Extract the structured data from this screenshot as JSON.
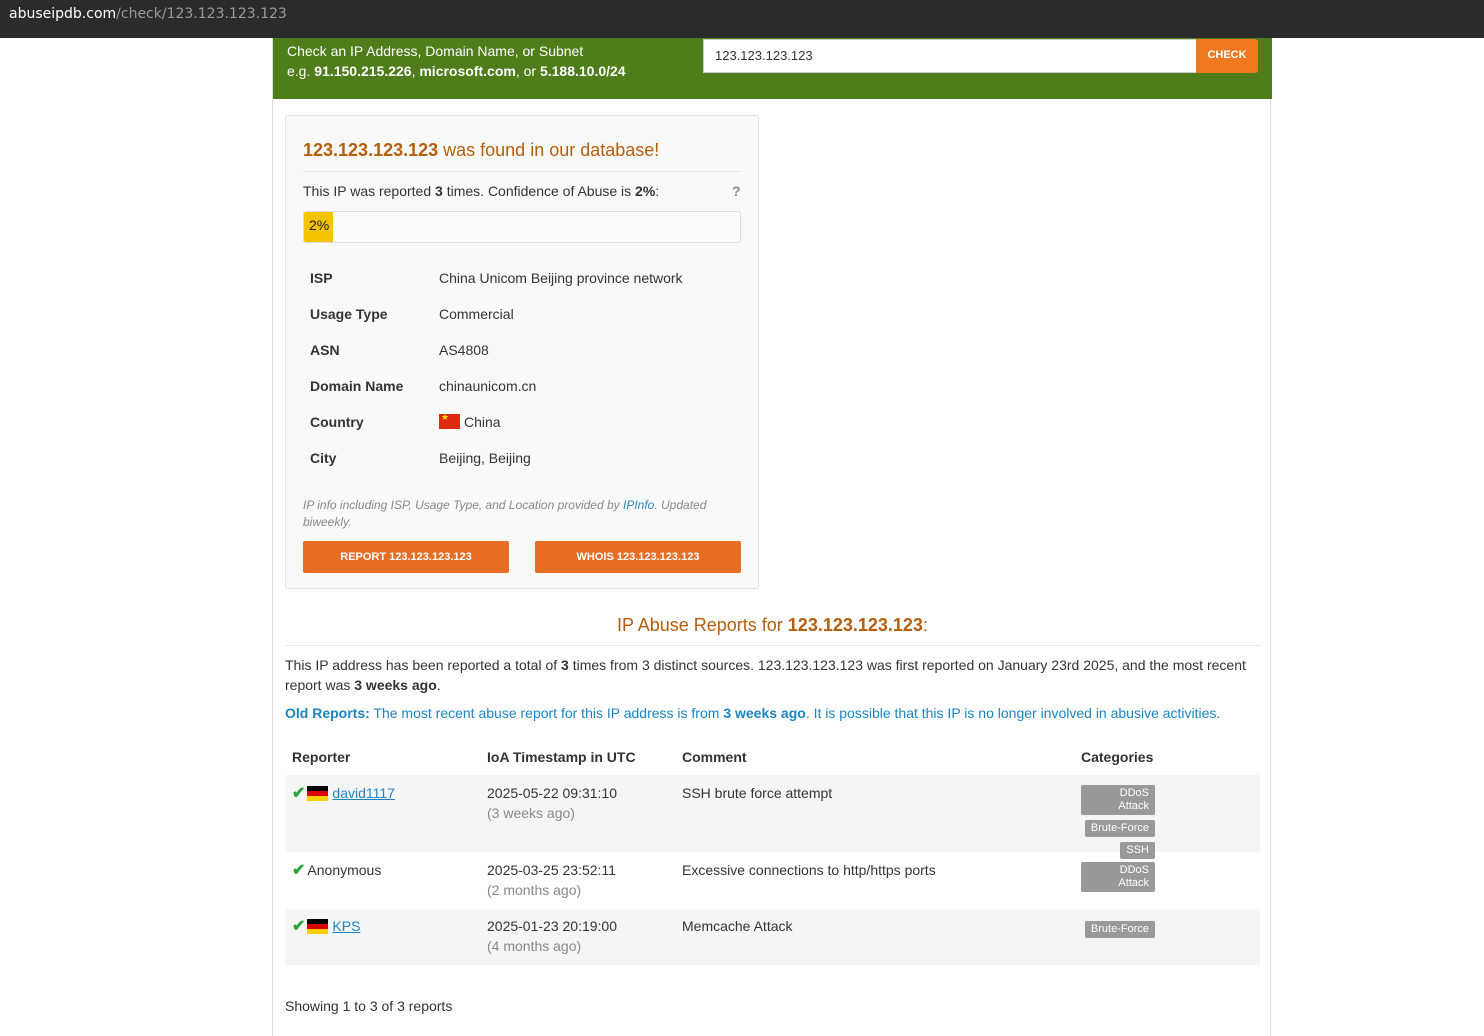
{
  "browser": {
    "host": "abuseipdb.com",
    "path": "/check/123.123.123.123"
  },
  "hero": {
    "line1": "Check an IP Address, Domain Name, or Subnet",
    "line2_prefix": "e.g. ",
    "ex1": "91.150.215.226",
    "sep1": ", ",
    "ex2": "microsoft.com",
    "sep2": ", or ",
    "ex3": "5.188.10.0/24",
    "search_value": "123.123.123.123",
    "check_label": "CHECK"
  },
  "result": {
    "ip": "123.123.123.123",
    "found_text": " was found in our database!",
    "reported_prefix": "This IP was reported ",
    "report_count": "3",
    "reported_mid": " times. Confidence of Abuse is ",
    "confidence": "2%",
    "reported_suffix": ":",
    "help": "?",
    "confidence_fraction": 0.02,
    "info": [
      {
        "key": "ISP",
        "value": "China Unicom Beijing province network"
      },
      {
        "key": "Usage Type",
        "value": "Commercial"
      },
      {
        "key": "ASN",
        "value": "AS4808"
      },
      {
        "key": "Domain Name",
        "value": "chinaunicom.cn"
      },
      {
        "key": "Country",
        "value": "China"
      },
      {
        "key": "City",
        "value": "Beijing, Beijing"
      }
    ],
    "note_prefix": "IP info including ISP, Usage Type, and Location provided by ",
    "note_link": "IPInfo",
    "note_suffix": ". Updated biweekly.",
    "report_button": "REPORT 123.123.123.123",
    "whois_button": "WHOIS 123.123.123.123"
  },
  "reports": {
    "title_prefix": "IP Abuse Reports for ",
    "title_ip": "123.123.123.123",
    "title_suffix": ":",
    "summary_a": "This IP address has been reported a total of ",
    "summary_count": "3",
    "summary_b": " times from 3 distinct sources. 123.123.123.123 was first reported on January 23rd 2025, and the most recent report was ",
    "summary_recent": "3 weeks ago",
    "summary_c": ".",
    "old_label": "Old Reports:",
    "old_a": " The most recent abuse report for this IP address is from ",
    "old_recent": "3 weeks ago",
    "old_b": ". It is possible that this IP is no longer involved in abusive activities.",
    "headers": {
      "reporter": "Reporter",
      "timestamp": "IoA Timestamp in UTC",
      "comment": "Comment",
      "categories": "Categories"
    },
    "rows": [
      {
        "reporter": "david1117",
        "timestamp": "2025-05-22 09:31:10",
        "ago": "(3 weeks ago)",
        "comment": "SSH brute force attempt",
        "categories": [
          "DDoS Attack",
          "Brute-Force",
          "SSH"
        ]
      },
      {
        "reporter": "Anonymous",
        "timestamp": "2025-03-25 23:52:11",
        "ago": "(2 months ago)",
        "comment": "Excessive connections to http/https ports",
        "categories": [
          "DDoS Attack"
        ]
      },
      {
        "reporter": "KPS",
        "timestamp": "2025-01-23 20:19:00",
        "ago": "(4 months ago)",
        "comment": "Memcache Attack",
        "categories": [
          "Brute-Force"
        ]
      }
    ],
    "footer": "Showing 1 to 3 of 3 reports"
  }
}
